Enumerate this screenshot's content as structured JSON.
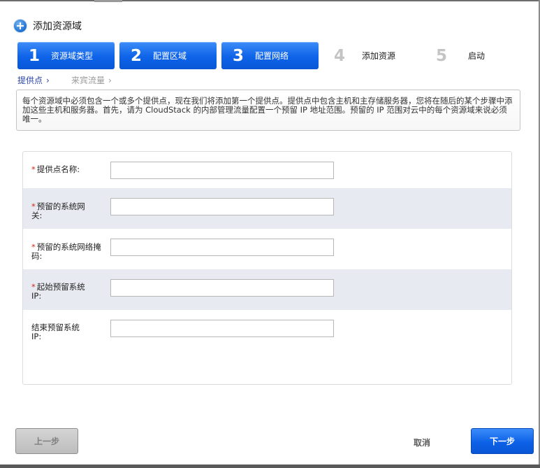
{
  "dialog": {
    "title": "添加资源域",
    "icon": "add-circle-icon"
  },
  "steps": [
    {
      "num": "1",
      "label": "资源域类型",
      "active": true
    },
    {
      "num": "2",
      "label": "配置区域",
      "active": true
    },
    {
      "num": "3",
      "label": "配置网络",
      "active": true
    },
    {
      "num": "4",
      "label": "添加资源",
      "active": false
    },
    {
      "num": "5",
      "label": "启动",
      "active": false
    }
  ],
  "subnav": [
    {
      "label": "提供点",
      "active": true
    },
    {
      "label": "来宾流量",
      "active": false
    }
  ],
  "description": "每个资源域中必须包含一个或多个提供点，现在我们将添加第一个提供点。提供点中包含主机和主存储服务器，您将在随后的某个步骤中添加这些主机和服务器。首先，请为 CloudStack 的内部管理流量配置一个预留 IP 地址范围。预留的 IP 范围对云中的每个资源域来说必须唯一。",
  "form": {
    "fields": [
      {
        "label": "提供点名称:",
        "required": true,
        "value": ""
      },
      {
        "label": "预留的系统网关:",
        "required": true,
        "value": ""
      },
      {
        "label": "预留的系统网络掩码:",
        "required": true,
        "value": ""
      },
      {
        "label": "起始预留系统 IP:",
        "required": true,
        "value": ""
      },
      {
        "label": "结束预留系统 IP:",
        "required": false,
        "value": ""
      }
    ]
  },
  "buttons": {
    "prev": "上一步",
    "cancel": "取消",
    "next": "下一步"
  },
  "colors": {
    "accent": "#0e63e8",
    "required": "#d12a1a",
    "row_shade": "#e7eaf0"
  }
}
